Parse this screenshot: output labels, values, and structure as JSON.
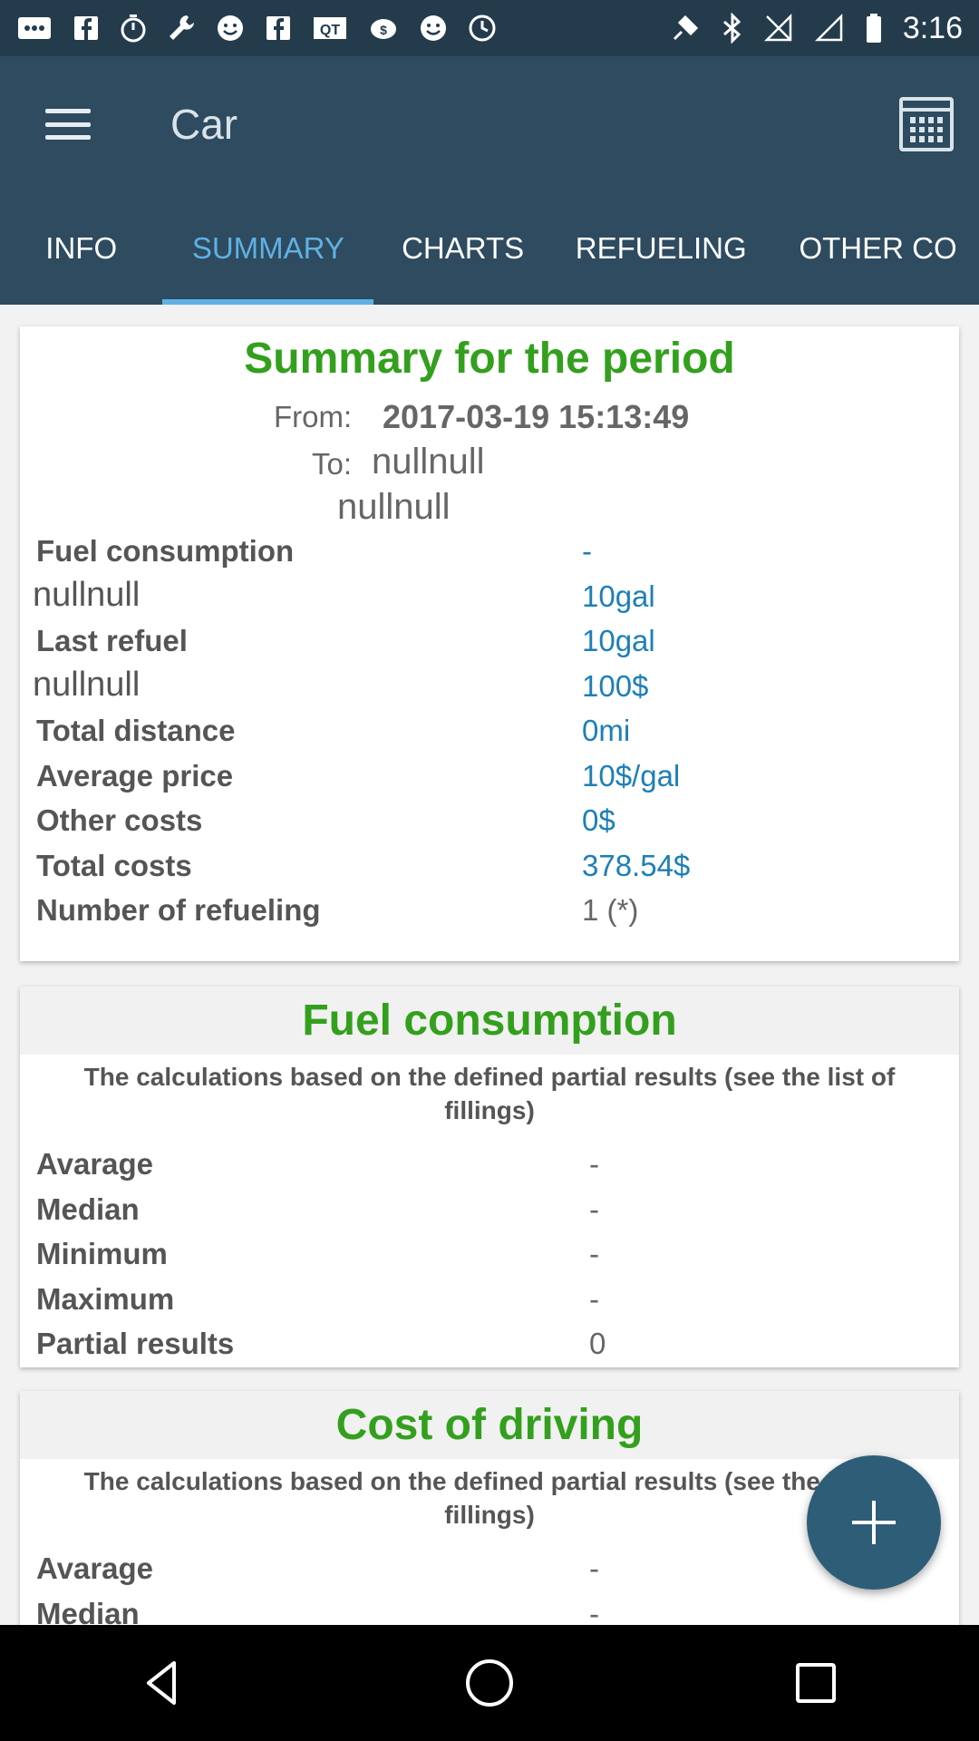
{
  "status_bar": {
    "time": "3:16",
    "left_icons": [
      "message-icon",
      "facebook-icon",
      "timer-icon",
      "wrench-icon",
      "smiley-icon",
      "facebook-icon",
      "qt-icon",
      "dollar-pig-icon",
      "smiley-icon",
      "clock-icon"
    ],
    "right_icons": [
      "fake-gps-icon",
      "bluetooth-icon",
      "signal-off-icon",
      "data-off-icon",
      "battery-icon"
    ]
  },
  "toolbar": {
    "title": "Car",
    "menu_icon": "hamburger-icon",
    "calendar_icon": "calendar-icon"
  },
  "tabs": [
    {
      "label": "INFO",
      "active": false
    },
    {
      "label": "SUMMARY",
      "active": true
    },
    {
      "label": "CHARTS",
      "active": false
    },
    {
      "label": "REFUELING",
      "active": false
    },
    {
      "label": "OTHER CO",
      "active": false
    }
  ],
  "summary": {
    "title": "Summary for the period",
    "from_label": "From:",
    "from_value": "2017-03-19 15:13:49",
    "to_label": "To:",
    "to_value": "nullnull",
    "to_value2": "nullnull",
    "rows": [
      {
        "label": "Fuel consumption",
        "value": "-"
      },
      {
        "label": "nullnull",
        "value": "10gal"
      },
      {
        "label": "Last refuel",
        "value": "10gal"
      },
      {
        "label": "nullnull",
        "value": "100$"
      },
      {
        "label": "Total distance",
        "value": "0mi"
      },
      {
        "label": "Average price",
        "value": "10$/gal"
      },
      {
        "label": "Other costs",
        "value": "0$"
      },
      {
        "label": "Total costs",
        "value": "378.54$"
      },
      {
        "label": "Number of refueling",
        "value": "1 (*)"
      }
    ]
  },
  "fuel_consumption": {
    "title": "Fuel consumption",
    "note": "The calculations based on the defined partial results (see the list of fillings)",
    "rows": [
      {
        "label": "Avarage",
        "value": "-"
      },
      {
        "label": "Median",
        "value": "-"
      },
      {
        "label": "Minimum",
        "value": "-"
      },
      {
        "label": "Maximum",
        "value": "-"
      },
      {
        "label": "Partial results",
        "value": "0"
      }
    ]
  },
  "cost_of_driving": {
    "title": "Cost of driving",
    "note": "The calculations based on the defined partial results (see the list of fillings)",
    "rows": [
      {
        "label": "Avarage",
        "value": "-"
      },
      {
        "label": "Median",
        "value": "-"
      }
    ]
  },
  "fab": {
    "icon": "plus-icon"
  },
  "nav_bar": {
    "icons": [
      "back-icon",
      "home-icon",
      "recents-icon"
    ]
  },
  "colors": {
    "toolbar": "#2e4b5f",
    "status_bar": "#243b4c",
    "accent": "#5fb1e3",
    "card_title": "#33a01d",
    "value": "#1d7fb8",
    "fab": "#2e5d78"
  }
}
